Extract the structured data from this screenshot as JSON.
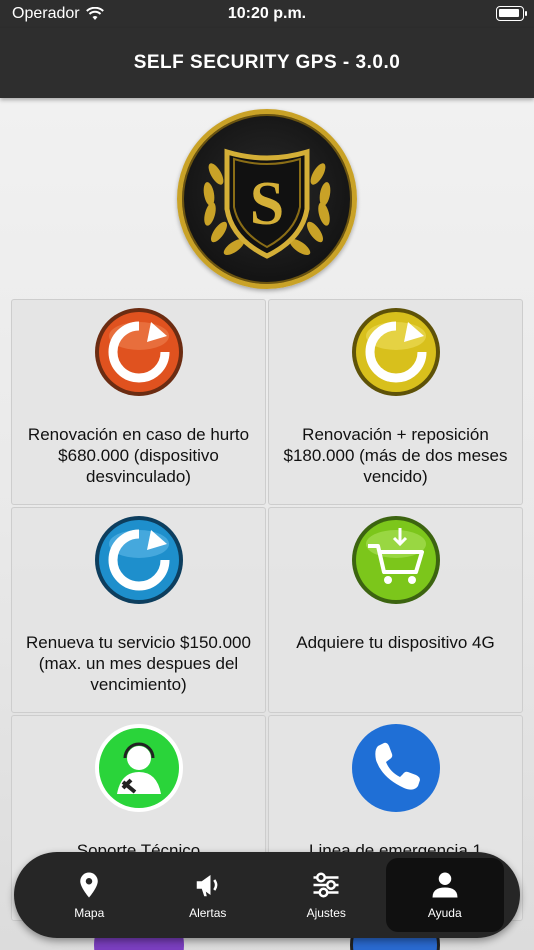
{
  "status_bar": {
    "carrier": "Operador",
    "time": "10:20 p.m."
  },
  "header": {
    "title": "SELF SECURITY GPS - 3.0.0"
  },
  "logo": {
    "letter": "S"
  },
  "cards": [
    {
      "label": "Renovación en caso de hurto $680.000 (dispositivo desvinculado)",
      "icon": "renew-orange-icon",
      "color": "#e0521f"
    },
    {
      "label": "Renovación + reposición $180.000 (más de dos meses vencido)",
      "icon": "renew-yellow-icon",
      "color": "#d8c01c"
    },
    {
      "label": "Renueva tu servicio $150.000 (max. un mes despues del vencimiento)",
      "icon": "renew-blue-icon",
      "color": "#1e8fcc"
    },
    {
      "label": "Adquiere tu dispositivo 4G",
      "icon": "shopping-cart-icon",
      "color": "#7cc61b"
    },
    {
      "label": "Soporte Técnico",
      "icon": "support-agent-icon",
      "color": "#2ad43a"
    },
    {
      "label": "Linea de emergencia 1",
      "icon": "phone-icon",
      "color": "#1f6fd6"
    }
  ],
  "tabs": [
    {
      "label": "Mapa",
      "icon": "map-pin-icon",
      "active": false
    },
    {
      "label": "Alertas",
      "icon": "megaphone-icon",
      "active": false
    },
    {
      "label": "Ajustes",
      "icon": "sliders-icon",
      "active": false
    },
    {
      "label": "Ayuda",
      "icon": "user-icon",
      "active": true
    }
  ]
}
